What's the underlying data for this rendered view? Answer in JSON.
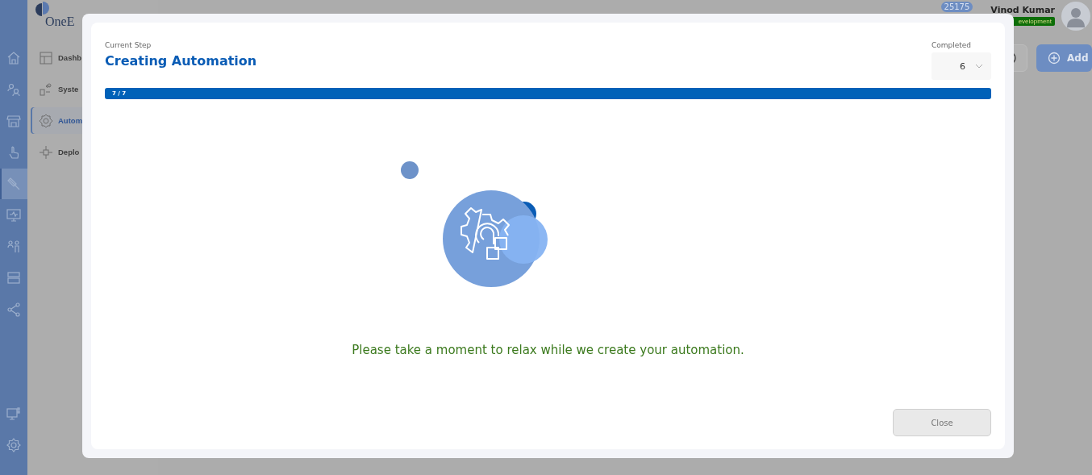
{
  "app": {
    "logo": "OneE",
    "rail_items": [
      {
        "selected": false
      },
      {
        "selected": false
      },
      {
        "selected": false
      },
      {
        "selected": false
      },
      {
        "selected": true
      },
      {
        "selected": false
      },
      {
        "selected": false
      },
      {
        "selected": false
      },
      {
        "selected": false
      }
    ],
    "rail_bottom_items": [
      {
        "selected": false
      },
      {
        "selected": false
      }
    ],
    "sidebar_items": [
      {
        "label": "Dashb",
        "selected": false
      },
      {
        "label": "Syste",
        "selected": false
      },
      {
        "label": "Autom",
        "selected": true
      },
      {
        "label": "Deplo",
        "selected": false
      }
    ],
    "header": {
      "badge": "25175",
      "user_name": "Vinod Kumar",
      "environment": "evelopment"
    },
    "toolbar": {
      "add_button": "Add"
    }
  },
  "dialog": {
    "step_label": "Current Step",
    "step_title": "Creating Automation",
    "completed": {
      "label": "Completed",
      "value": "6"
    },
    "progress": {
      "text": "7 / 7",
      "level": 1
    },
    "message": "Please take a moment to relax while we create your automation.",
    "close_button": "Close"
  }
}
